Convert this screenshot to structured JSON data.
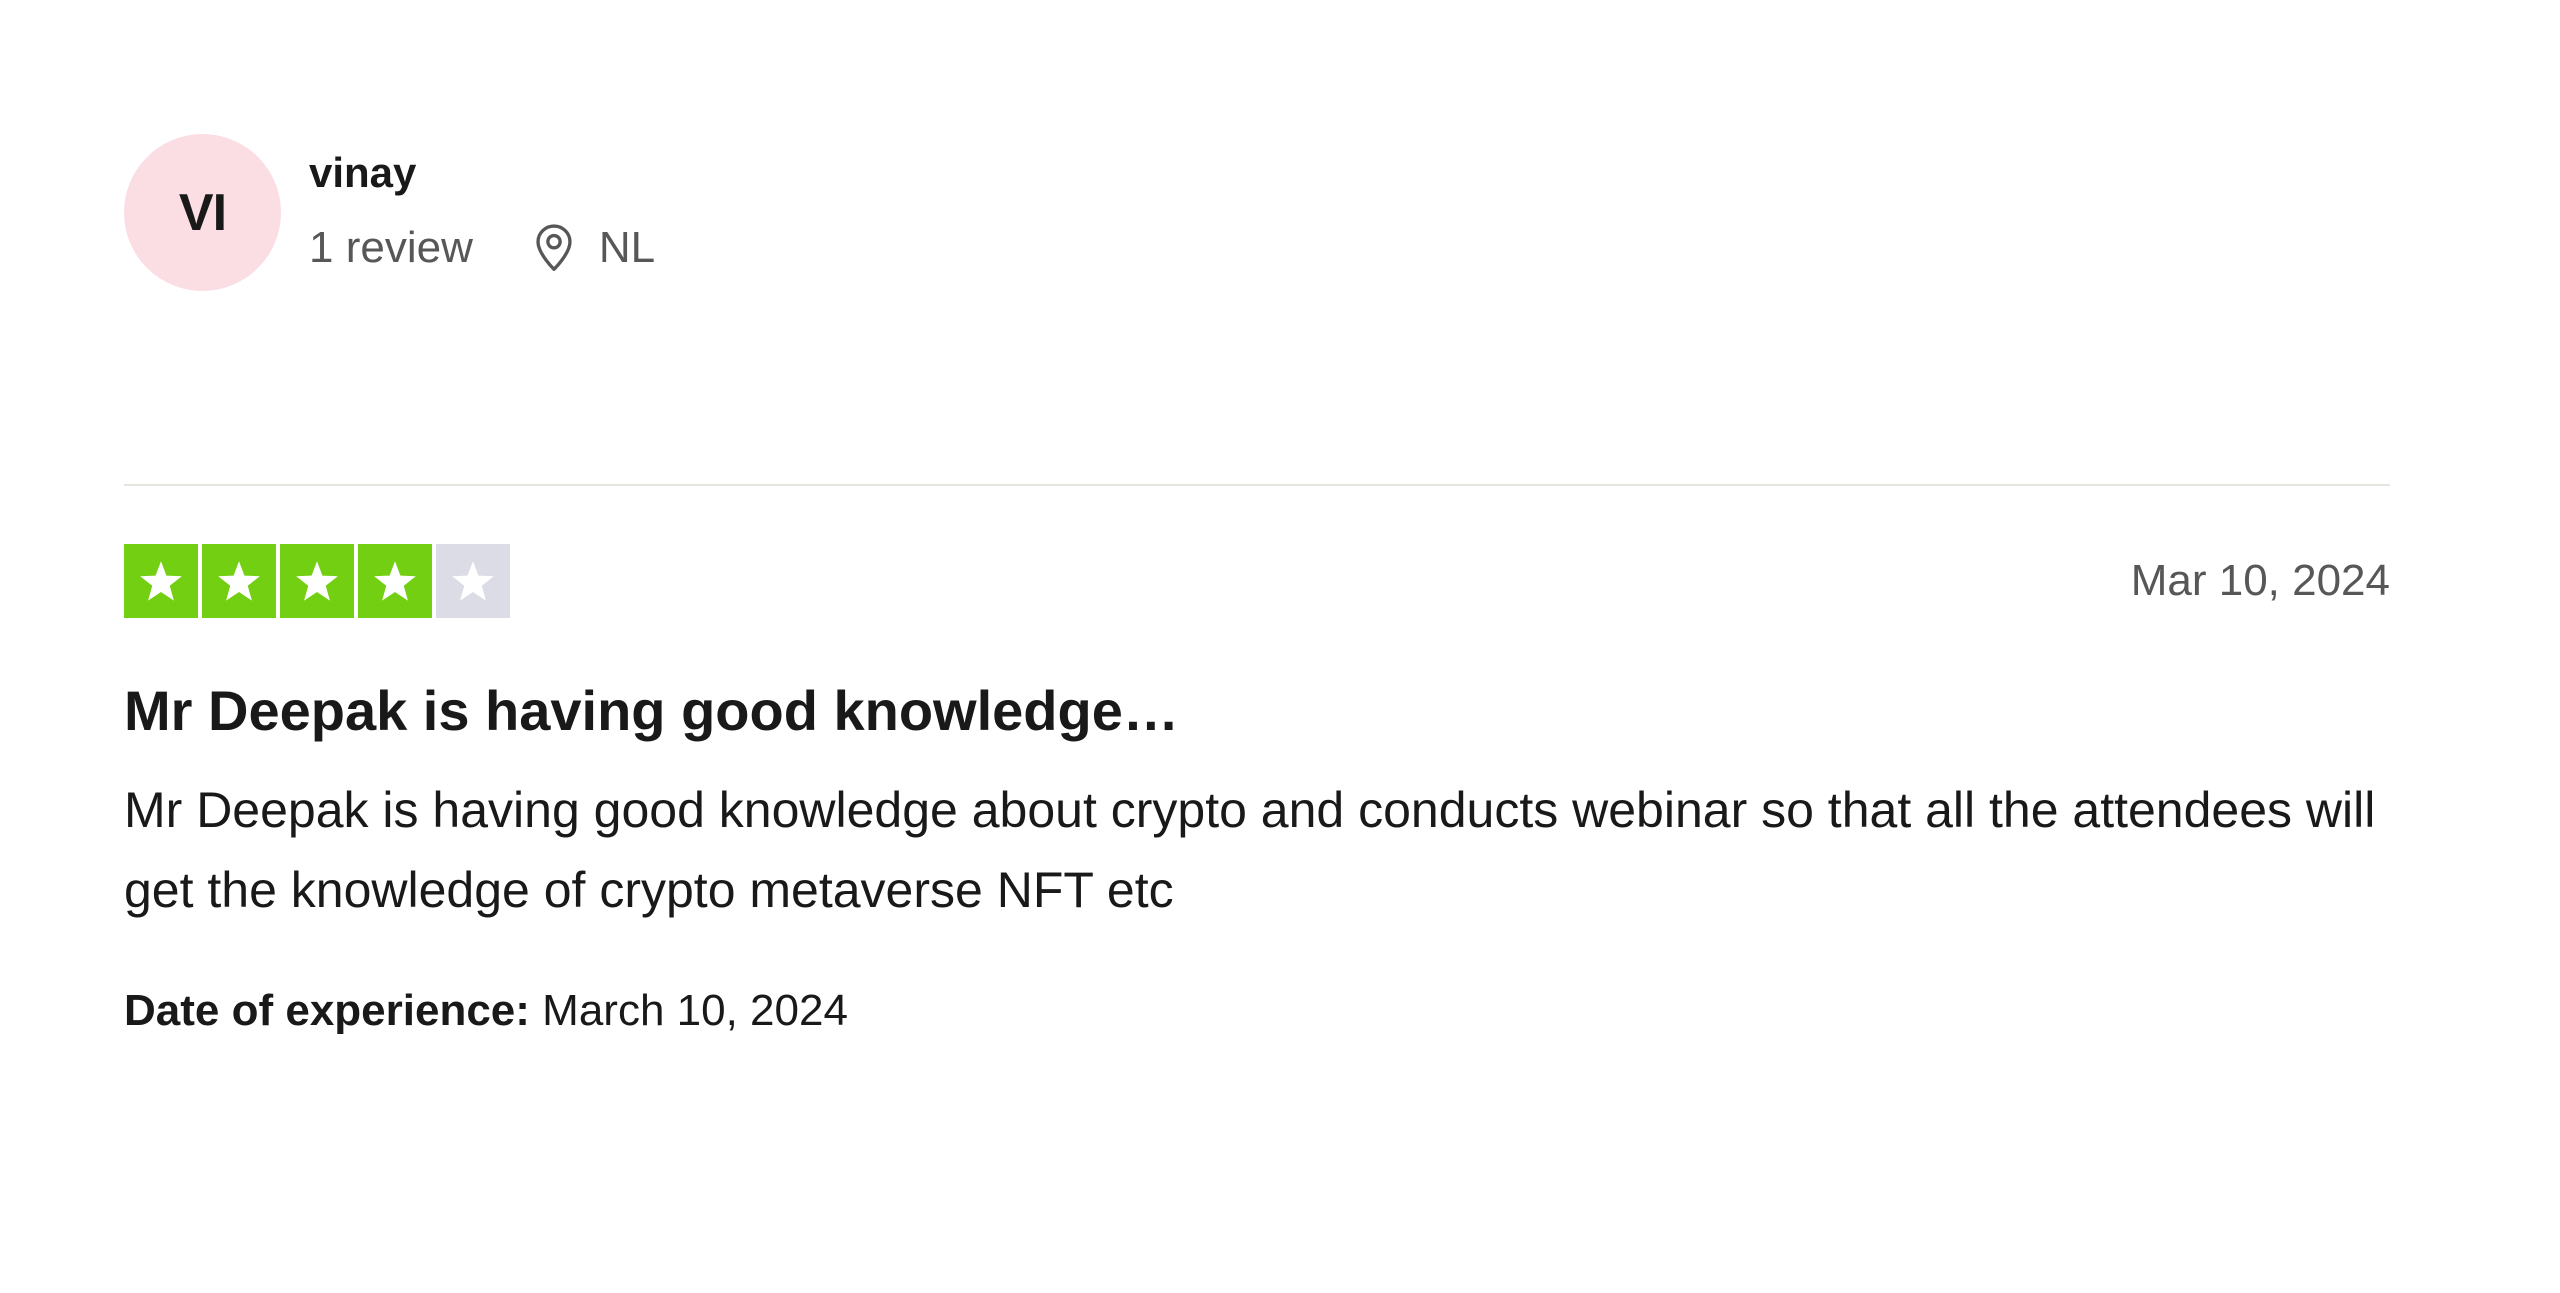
{
  "consumer": {
    "initials": "VI",
    "name": "vinay",
    "reviews_count": "1 review",
    "location": "NL",
    "avatar_color": "#fbdde4"
  },
  "review": {
    "rating": 4,
    "max_rating": 5,
    "star_colors": {
      "filled": "#73cf11",
      "empty": "#dcdce6"
    },
    "date": "Mar 10, 2024",
    "title": "Mr Deepak is having good knowledge…",
    "body": "Mr Deepak is having good knowledge about crypto and conducts webinar so that all the attendees will get the knowledge of crypto metaverse NFT etc",
    "experience_label": "Date of experience:",
    "experience_date": "March 10, 2024"
  },
  "icons": {
    "location": "location-pin-icon",
    "star": "star-icon"
  }
}
